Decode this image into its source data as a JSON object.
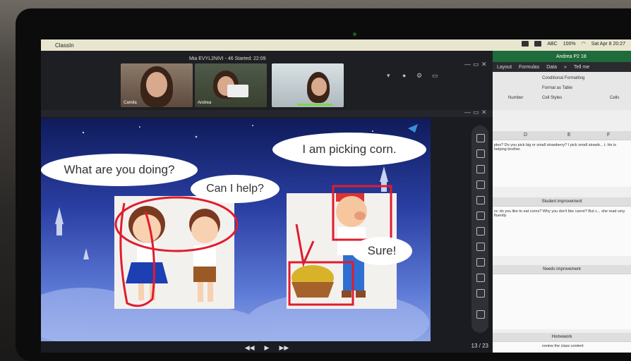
{
  "menubar": {
    "app_name": "ClassIn",
    "battery": "100%",
    "date_time": "Sat Apr 8  20:27",
    "abc": "ABC"
  },
  "classroom": {
    "title": "Mia EVYL2NIVI - 46   Started: 22:09",
    "participants": [
      "Camila",
      "Andrea",
      ""
    ]
  },
  "slide": {
    "bubbles": {
      "q1": "What are you doing?",
      "q2": "Can I help?",
      "a1": "I am picking corn.",
      "a2": "Sure!"
    },
    "page": "13 / 23"
  },
  "excel": {
    "workbook": "Andrea P2 18",
    "menu": [
      "Layout",
      "Formulas",
      "Data",
      "»",
      "Tell me"
    ],
    "ribbon_labels": [
      "Number",
      "Conditional Formatting",
      "Format as Table",
      "Cell Styles",
      "Cells"
    ],
    "columns": [
      "D",
      "E",
      "F"
    ],
    "rows": {
      "text1": "ples? Do you pick big or small strawberry? I pick small strawb... t. He is helping brother.",
      "title2": "Student improvement",
      "text2": "rs: do you like to eat corns? Why you don't like carrot? But c... she read very fluently",
      "title3": "Needs improvement",
      "title4": "Homework",
      "text4": "review the class content"
    }
  },
  "colors": {
    "menubar": "#e9e6cf",
    "excel_green": "#1f6b3b",
    "annotation_red": "#e01c2e"
  }
}
